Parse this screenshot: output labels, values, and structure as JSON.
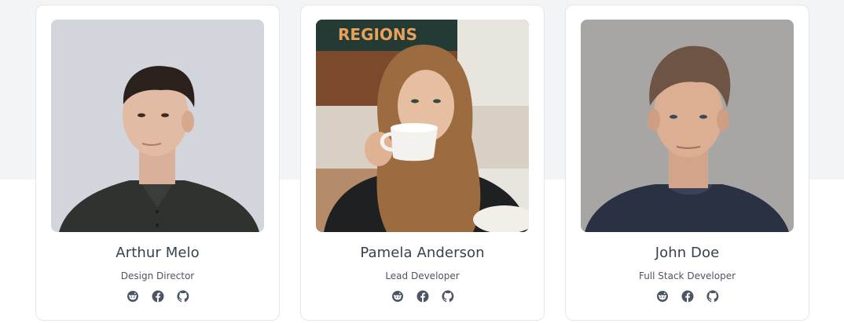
{
  "colors": {
    "section_bg": "#f3f4f6",
    "card_bg": "#ffffff",
    "card_border": "#e4e6ea",
    "name_text": "#374151",
    "role_text": "#4b5563",
    "icon": "#4b5563"
  },
  "team": [
    {
      "name": "Arthur Melo",
      "role": "Design Director",
      "photo": "portrait-young-man-dark-shirt",
      "socials": [
        "reddit-icon",
        "facebook-icon",
        "github-icon"
      ]
    },
    {
      "name": "Pamela Anderson",
      "role": "Lead Developer",
      "photo": "portrait-woman-drinking-coffee",
      "socials": [
        "reddit-icon",
        "facebook-icon",
        "github-icon"
      ]
    },
    {
      "name": "John Doe",
      "role": "Full Stack Developer",
      "photo": "portrait-man-navy-tshirt",
      "socials": [
        "reddit-icon",
        "facebook-icon",
        "github-icon"
      ]
    }
  ],
  "photo_signs": {
    "cafe_sign": "REGIONS"
  }
}
